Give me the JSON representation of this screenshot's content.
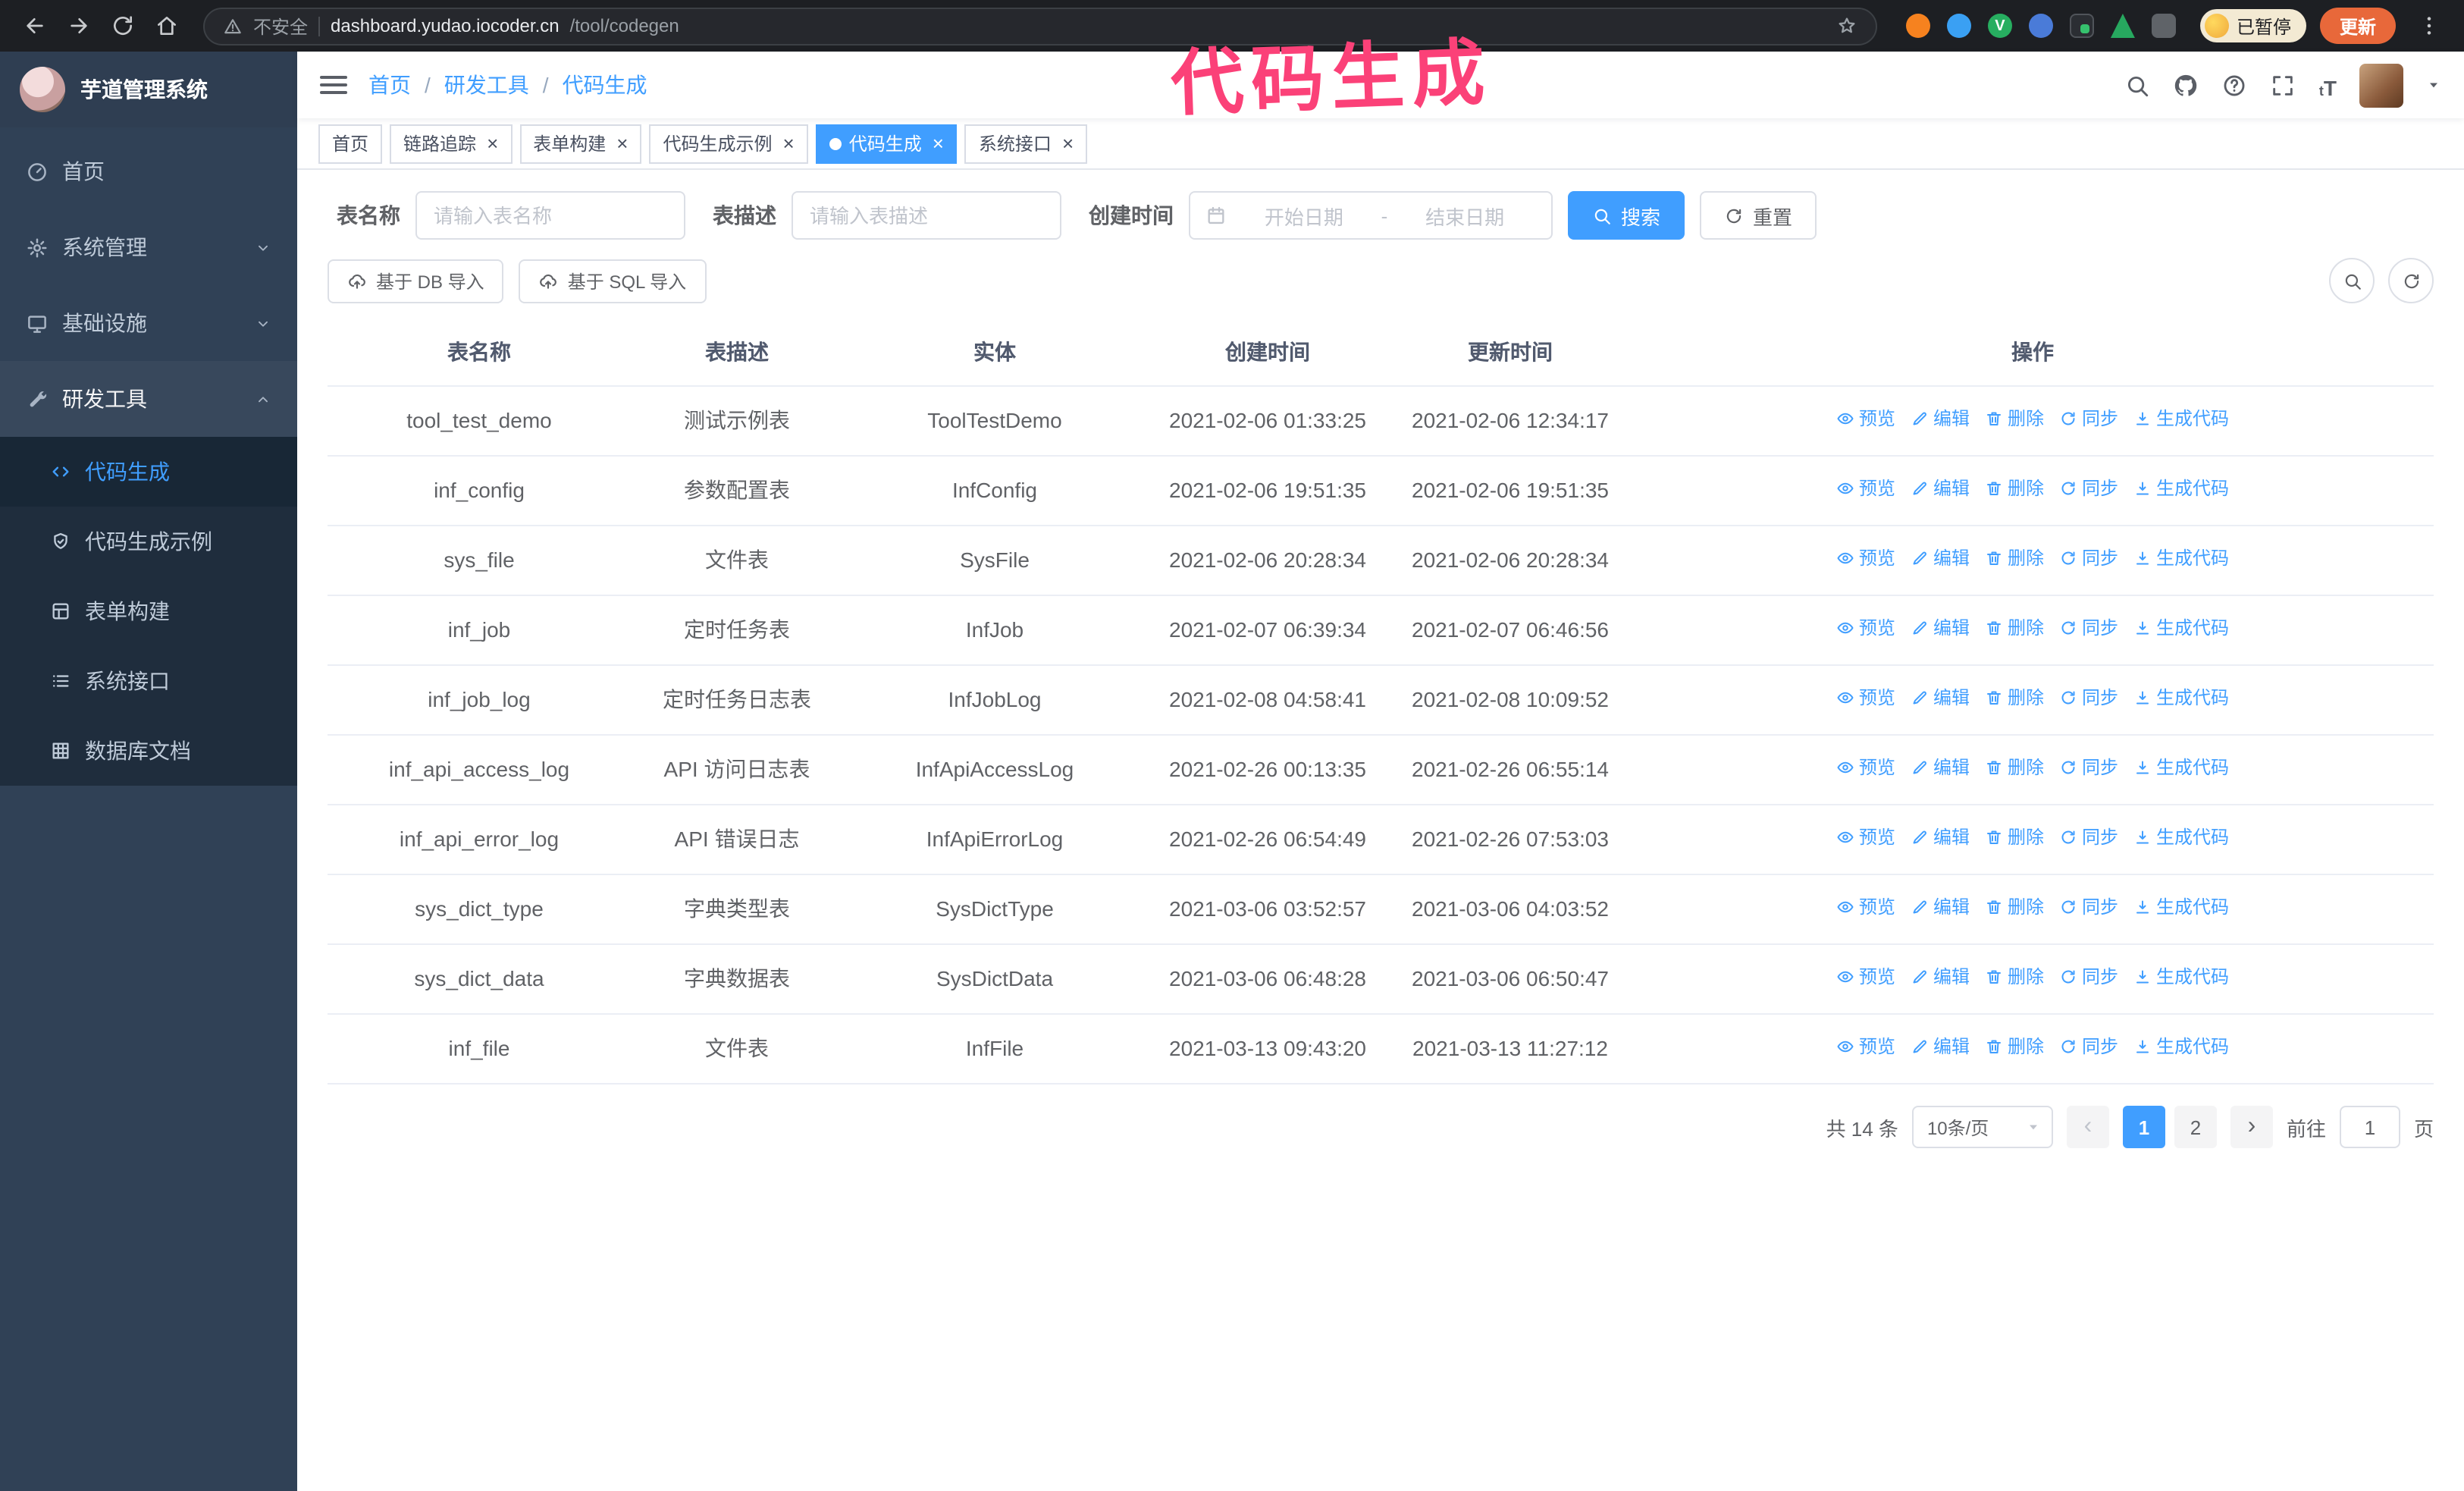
{
  "browser": {
    "security_label": "不安全",
    "url_host": "dashboard.yudao.iocoder.cn",
    "url_path": "/tool/codegen",
    "paused_label": "已暂停",
    "update_label": "更新"
  },
  "annotation": {
    "text": "代码生成",
    "color": "#fb4178"
  },
  "sidebar": {
    "logo_title": "芋道管理系统",
    "menu": [
      {
        "id": "home",
        "label": "首页",
        "icon": "dashboard-icon"
      },
      {
        "id": "system",
        "label": "系统管理",
        "icon": "gear-icon",
        "arrow": "down"
      },
      {
        "id": "infra",
        "label": "基础设施",
        "icon": "infra-icon",
        "arrow": "down"
      },
      {
        "id": "devtools",
        "label": "研发工具",
        "icon": "tools-icon",
        "arrow": "up",
        "children": [
          {
            "id": "codegen",
            "label": "代码生成",
            "icon": "code-icon",
            "active": true
          },
          {
            "id": "codegen-demo",
            "label": "代码生成示例",
            "icon": "shield-icon"
          },
          {
            "id": "form-builder",
            "label": "表单构建",
            "icon": "form-icon"
          },
          {
            "id": "system-api",
            "label": "系统接口",
            "icon": "api-icon"
          },
          {
            "id": "db-doc",
            "label": "数据库文档",
            "icon": "db-icon"
          }
        ]
      }
    ]
  },
  "header": {
    "breadcrumb": [
      "首页",
      "研发工具",
      "代码生成"
    ]
  },
  "tabs": [
    {
      "id": "home",
      "label": "首页",
      "closable": false
    },
    {
      "id": "tracing",
      "label": "链路追踪",
      "closable": true
    },
    {
      "id": "form-builder",
      "label": "表单构建",
      "closable": true
    },
    {
      "id": "codegen-demo",
      "label": "代码生成示例",
      "closable": true
    },
    {
      "id": "codegen",
      "label": "代码生成",
      "closable": true,
      "active": true
    },
    {
      "id": "system-api",
      "label": "系统接口",
      "closable": true
    }
  ],
  "filters": {
    "table_name_label": "表名称",
    "table_name_placeholder": "请输入表名称",
    "table_desc_label": "表描述",
    "table_desc_placeholder": "请输入表描述",
    "create_time_label": "创建时间",
    "date_start_placeholder": "开始日期",
    "date_separator": "-",
    "date_end_placeholder": "结束日期",
    "search_label": "搜索",
    "reset_label": "重置"
  },
  "toolbar": {
    "import_db_label": "基于 DB 导入",
    "import_sql_label": "基于 SQL 导入"
  },
  "table": {
    "columns": [
      "表名称",
      "表描述",
      "实体",
      "创建时间",
      "更新时间",
      "操作"
    ],
    "actions": [
      {
        "id": "preview",
        "label": "预览",
        "icon": "eye-icon"
      },
      {
        "id": "edit",
        "label": "编辑",
        "icon": "edit-icon"
      },
      {
        "id": "delete",
        "label": "删除",
        "icon": "delete-icon"
      },
      {
        "id": "sync",
        "label": "同步",
        "icon": "sync-icon"
      },
      {
        "id": "generate-code",
        "label": "生成代码",
        "icon": "download-icon"
      }
    ],
    "rows": [
      {
        "name": "tool_test_demo",
        "desc": "测试示例表",
        "entity": "ToolTestDemo",
        "created": "2021-02-06 01:33:25",
        "updated": "2021-02-06 12:34:17"
      },
      {
        "name": "inf_config",
        "desc": "参数配置表",
        "entity": "InfConfig",
        "created": "2021-02-06 19:51:35",
        "updated": "2021-02-06 19:51:35"
      },
      {
        "name": "sys_file",
        "desc": "文件表",
        "entity": "SysFile",
        "created": "2021-02-06 20:28:34",
        "updated": "2021-02-06 20:28:34"
      },
      {
        "name": "inf_job",
        "desc": "定时任务表",
        "entity": "InfJob",
        "created": "2021-02-07 06:39:34",
        "updated": "2021-02-07 06:46:56"
      },
      {
        "name": "inf_job_log",
        "desc": "定时任务日志表",
        "entity": "InfJobLog",
        "created": "2021-02-08 04:58:41",
        "updated": "2021-02-08 10:09:52"
      },
      {
        "name": "inf_api_access_log",
        "desc": "API 访问日志表",
        "entity": "InfApiAccessLog",
        "created": "2021-02-26 00:13:35",
        "updated": "2021-02-26 06:55:14"
      },
      {
        "name": "inf_api_error_log",
        "desc": "API 错误日志",
        "entity": "InfApiErrorLog",
        "created": "2021-02-26 06:54:49",
        "updated": "2021-02-26 07:53:03"
      },
      {
        "name": "sys_dict_type",
        "desc": "字典类型表",
        "entity": "SysDictType",
        "created": "2021-03-06 03:52:57",
        "updated": "2021-03-06 04:03:52"
      },
      {
        "name": "sys_dict_data",
        "desc": "字典数据表",
        "entity": "SysDictData",
        "created": "2021-03-06 06:48:28",
        "updated": "2021-03-06 06:50:47"
      },
      {
        "name": "inf_file",
        "desc": "文件表",
        "entity": "InfFile",
        "created": "2021-03-13 09:43:20",
        "updated": "2021-03-13 11:27:12"
      }
    ]
  },
  "pagination": {
    "total": "共 14 条",
    "page_size": "10条/页",
    "prev_label": "‹",
    "next_label": "›",
    "pages": [
      {
        "label": "1",
        "active": true
      },
      {
        "label": "2"
      }
    ],
    "goto_label": "前往",
    "goto_value": "1",
    "goto_suffix": "页"
  },
  "colors": {
    "accent": "#409eff",
    "sidebar_bg": "#304156",
    "submenu_bg": "#1f2d3d",
    "annotation": "#fb4178",
    "update_button": "#e8683a"
  }
}
